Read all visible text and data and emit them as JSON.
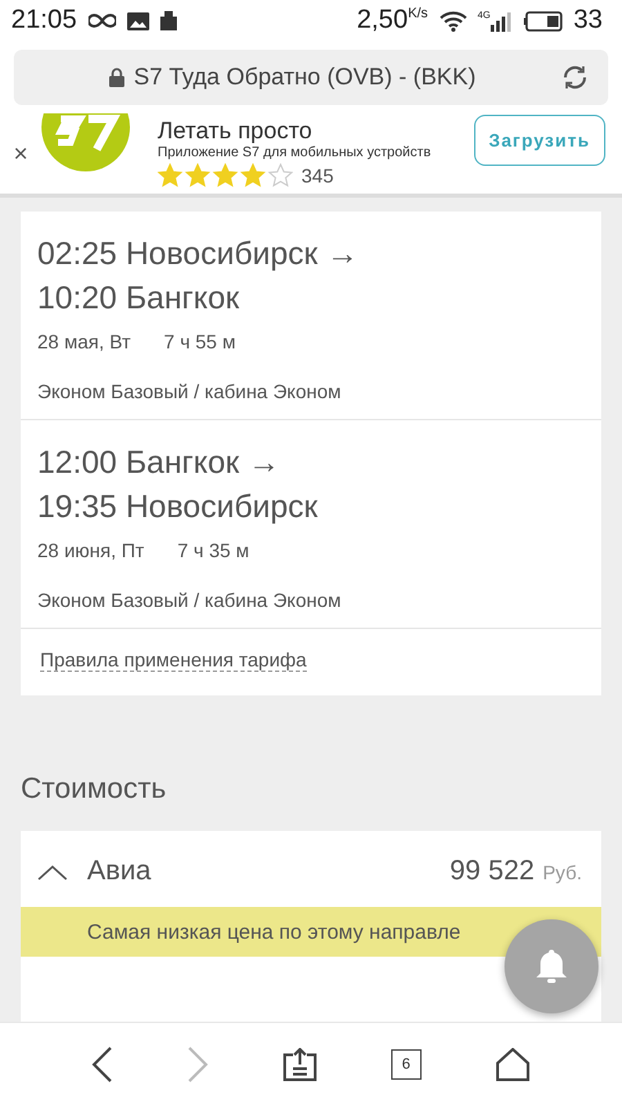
{
  "status_bar": {
    "time": "21:05",
    "speed": "2,50",
    "speed_unit": "K/s",
    "network": "4G",
    "battery": "33"
  },
  "address_bar": {
    "title": "S7 Туда Обратно (OVB) - (BKK)"
  },
  "app_banner": {
    "close": "×",
    "title": "Летать просто",
    "subtitle": "Приложение S7 для мобильных устройств",
    "stars": 4,
    "rating_count": "345",
    "button": "Загрузить"
  },
  "flights": [
    {
      "depart": "02:25 Новосибирск →",
      "arrive": "10:20 Бангкок",
      "date": "28 мая, Вт",
      "duration": "7 ч 55 м",
      "fare": "Эконом Базовый / кабина Эконом"
    },
    {
      "depart": "12:00 Бангкок →",
      "arrive": "19:35 Новосибирск",
      "date": "28 июня, Пт",
      "duration": "7 ч 35 м",
      "fare": "Эконом Базовый / кабина Эконом"
    }
  ],
  "fare_rules_link": "Правила применения тарифа",
  "cost": {
    "heading": "Стоимость",
    "item": {
      "label": "Авиа",
      "expanded": true,
      "amount": "99 522",
      "currency": "Руб.",
      "note": "Самая низкая цена по этому направле"
    }
  },
  "bottom_nav": {
    "tabs_count": "6"
  }
}
